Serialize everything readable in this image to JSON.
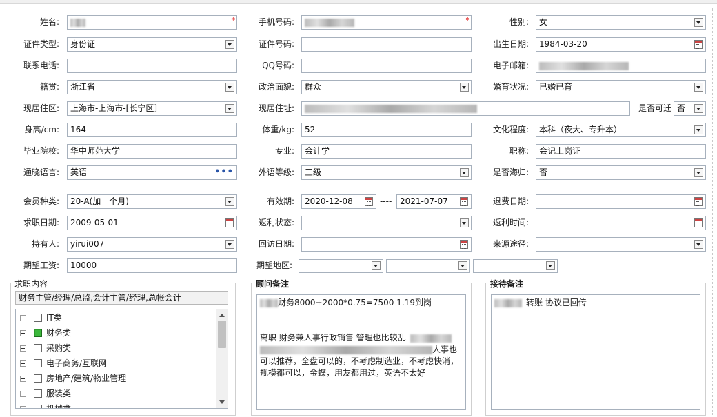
{
  "required_mark": "*",
  "row1": {
    "name_label": "姓名:",
    "phone_label": "手机号码:",
    "gender_label": "性别:",
    "gender_value": "女"
  },
  "row2": {
    "id_type_label": "证件类型:",
    "id_type_value": "身份证",
    "id_no_label": "证件号码:",
    "birth_label": "出生日期:",
    "birth_value": "1984-03-20"
  },
  "row3": {
    "contact_label": "联系电话:",
    "qq_label": "QQ号码:",
    "email_label": "电子邮箱:"
  },
  "row4": {
    "native_label": "籍贯:",
    "native_value": "浙江省",
    "politics_label": "政治面貌:",
    "politics_value": "群众",
    "marital_label": "婚育状况:",
    "marital_value": "已婚已育"
  },
  "row5": {
    "current_area_label": "现居住区:",
    "current_area_value": "上海市-上海市-[长宁区]",
    "current_addr_label": "现居住址:",
    "relocate_label": "是否可迁",
    "relocate_value": "否"
  },
  "row6": {
    "height_label": "身高/cm:",
    "height_value": "164",
    "weight_label": "体重/kg:",
    "weight_value": "52",
    "education_label": "文化程度:",
    "education_value": "本科（夜大、专升本）"
  },
  "row7": {
    "school_label": "毕业院校:",
    "school_value": "华中师范大学",
    "major_label": "专业:",
    "major_value": "会计学",
    "title_label": "职称:",
    "title_value": "会记上岗证"
  },
  "row8": {
    "language_label": "通晓语言:",
    "language_value": "英语",
    "language_more": "•••",
    "foreign_level_label": "外语等级:",
    "foreign_level_value": "三级",
    "overseas_label": "是否海归:",
    "overseas_value": "否"
  },
  "row9": {
    "member_type_label": "会员种类:",
    "member_type_value": "20-A(加一个月)",
    "validity_label": "有效期:",
    "validity_start": "2020-12-08",
    "validity_sep": "----",
    "validity_end": "2021-07-07",
    "refund_date_label": "退费日期:"
  },
  "row10": {
    "job_date_label": "求职日期:",
    "job_date_value": "2009-05-01",
    "rebate_status_label": "返利状态:",
    "rebate_time_label": "返利时间:"
  },
  "row11": {
    "holder_label": "持有人:",
    "holder_value": "yirui007",
    "visit_date_label": "回访日期:",
    "source_label": "来源途径:"
  },
  "row12": {
    "salary_label": "期望工资:",
    "salary_value": "10000",
    "region_label": "期望地区:"
  },
  "job_content": {
    "legend": "求职内容",
    "summary": "财务主管/经理/总监,会计主管/经理,总帐会计",
    "tree": [
      {
        "label": "IT类",
        "checked": false
      },
      {
        "label": "财务类",
        "checked": true
      },
      {
        "label": "采购类",
        "checked": false
      },
      {
        "label": "电子商务/互联网",
        "checked": false
      },
      {
        "label": "房地产/建筑/物业管理",
        "checked": false
      },
      {
        "label": "服装类",
        "checked": false
      },
      {
        "label": "机械类",
        "checked": false
      }
    ]
  },
  "consultant_notes": {
    "legend": "顾问备注",
    "line1": "财务8000+2000*0.75=7500   1.19到岗",
    "line3_a": "离职 财务兼人事行政销售  管理也比较乱",
    "line4_b": "人事也",
    "line5": "可以推荐，全盘可以的，不考虑制造业，不考虑快消，",
    "line6": "规模都可以，金蝶，用友都用过，英语不太好"
  },
  "reception_notes": {
    "legend": "接待备注",
    "line1": "转账 协议已回传"
  }
}
